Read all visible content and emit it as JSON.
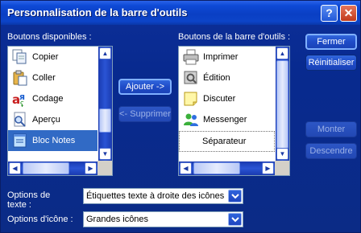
{
  "window": {
    "title": "Personnalisation de la barre d'outils",
    "help_glyph": "?",
    "close_glyph": "✕"
  },
  "available": {
    "label": "Boutons disponibles :",
    "items": [
      {
        "label": "Copier",
        "icon": "copy-icon"
      },
      {
        "label": "Coller",
        "icon": "paste-icon"
      },
      {
        "label": "Codage",
        "icon": "encoding-icon"
      },
      {
        "label": "Aperçu",
        "icon": "preview-icon"
      },
      {
        "label": "Bloc Notes",
        "icon": "notepad-icon",
        "selected": true
      }
    ]
  },
  "toolbar": {
    "label": "Boutons de la barre d'outils :",
    "items": [
      {
        "label": "Imprimer",
        "icon": "printer-icon"
      },
      {
        "label": "Édition",
        "icon": "edit-icon"
      },
      {
        "label": "Discuter",
        "icon": "discuss-icon"
      },
      {
        "label": "Messenger",
        "icon": "messenger-icon"
      },
      {
        "label": "Séparateur",
        "separator": true
      }
    ]
  },
  "buttons": {
    "add": "Ajouter ->",
    "remove": "<- Supprimer",
    "close": "Fermer",
    "reset": "Réinitialiser",
    "move_up": "Monter",
    "move_down": "Descendre"
  },
  "options": {
    "text_label": "Options de texte :",
    "text_value": "Étiquettes texte à droite des icônes",
    "icon_label": "Options d'icône :",
    "icon_value": "Grandes icônes"
  },
  "colors": {
    "accent": "#316ac5",
    "window_bg": "#0b2b86"
  }
}
